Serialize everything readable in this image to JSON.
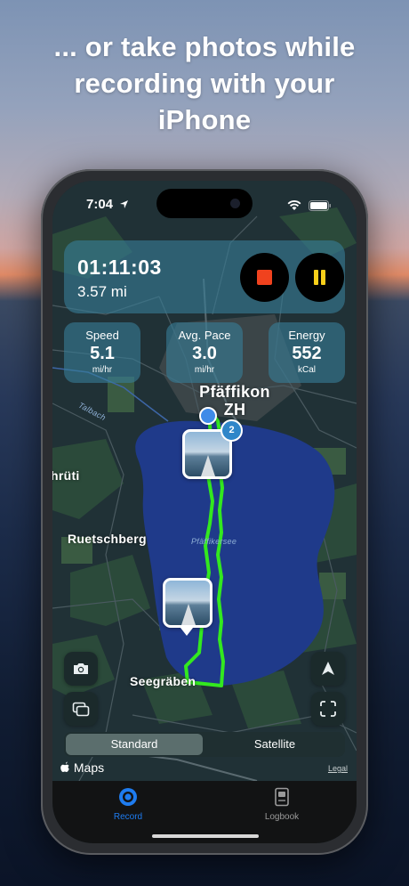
{
  "headline": [
    "... or take photos while",
    "recording with your",
    "iPhone"
  ],
  "status_bar": {
    "time": "7:04"
  },
  "recording": {
    "elapsed": "01:11:03",
    "distance": "3.57 mi",
    "stop_color": "#f0421e",
    "pause_color": "#f8cf1a"
  },
  "metrics": [
    {
      "label": "Speed",
      "value": "5.1",
      "unit": "mi/hr"
    },
    {
      "label": "Avg. Pace",
      "value": "3.0",
      "unit": "mi/hr"
    },
    {
      "label": "Energy",
      "value": "552",
      "unit": "kCal"
    }
  ],
  "map": {
    "town_labels": {
      "pfaeffikon": "Pfäffikon\nZH",
      "ruetschberg": "Ruetschberg",
      "seegraben": "Seegräben",
      "chruti": "hrüti"
    },
    "water_labels": {
      "lake": "Pfäffikersee",
      "stream": "Talbach"
    },
    "photo_cluster_count": "2",
    "track_color": "#33e81f",
    "lake_color": "#1f3a8a"
  },
  "map_type": {
    "options": [
      "Standard",
      "Satellite"
    ],
    "selected": "Standard"
  },
  "attribution": {
    "maps": "Maps",
    "legal": "Legal"
  },
  "tabs": [
    {
      "label": "Record",
      "active": true,
      "color": "#1e7cf0"
    },
    {
      "label": "Logbook",
      "active": false,
      "color": "#9a9a9a"
    }
  ]
}
